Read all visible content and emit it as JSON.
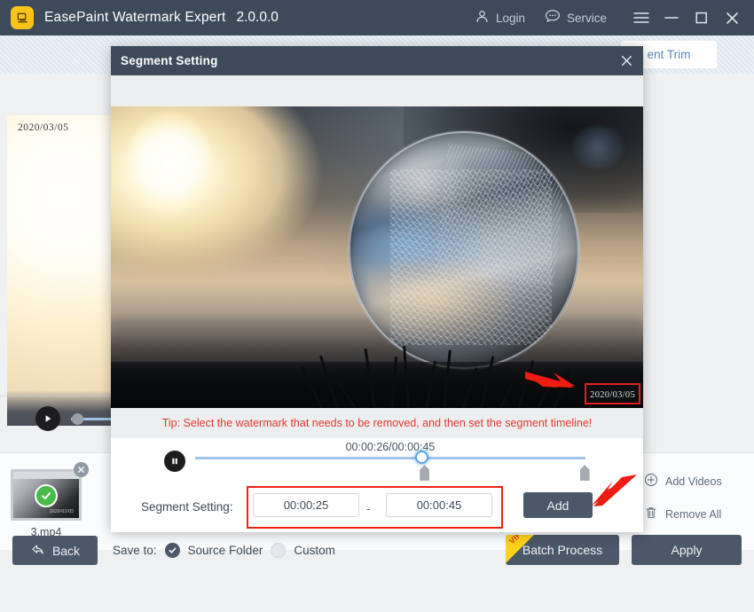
{
  "app": {
    "title": "EasePaint Watermark Expert",
    "version": "2.0.0.0",
    "logo_icon": "watermark-app-icon",
    "login_label": "Login",
    "login_icon": "user-icon",
    "service_label": "Service",
    "service_icon": "chat-bubble-icon",
    "menu_icon": "hamburger-menu-icon",
    "minimize_icon": "minimize-icon",
    "maximize_icon": "maximize-icon",
    "close_icon": "close-icon"
  },
  "background": {
    "tab_label": "ent Trim",
    "preview_watermark": "2020/03/05",
    "play_icon": "play-icon"
  },
  "filestrip": {
    "file_name": "3.mp4",
    "check_icon": "check-icon",
    "remove_icon": "close-icon",
    "thumb_watermark": "2020/03/05",
    "add_videos_label": "Add Videos",
    "add_videos_icon": "plus-circle-icon",
    "remove_all_label": "Remove All",
    "remove_all_icon": "trash-icon"
  },
  "bottom": {
    "back_label": "Back",
    "back_icon": "back-arrow-icon",
    "save_to_label": "Save to:",
    "source_folder_label": "Source Folder",
    "custom_label": "Custom",
    "batch_label": "Batch Process",
    "vip_badge": "VIP",
    "apply_label": "Apply"
  },
  "dialog": {
    "title": "Segment Setting",
    "close_icon": "close-icon",
    "video_watermark": "2020/03/05",
    "watermark_arrow_icon": "red-arrow-icon",
    "tip": "Tip: Select the watermark that needs to be removed, and then set the segment timeline!",
    "pause_icon": "pause-icon",
    "time_display": "00:00:26/00:00:45",
    "segment_label": "Segment Setting:",
    "start_time": "00:00:25",
    "end_time": "00:00:45",
    "range_separator": "-",
    "add_label": "Add",
    "add_arrow_icon": "red-arrow-icon"
  },
  "colors": {
    "titlebar": "#3c4a5a",
    "accent_button": "#4a586a",
    "tip_red": "#e23a2e",
    "highlight_red": "#ee2211",
    "track_blue": "#9ec5e8",
    "playhead_blue": "#5aa5e0",
    "vip_yellow": "#ffd21e",
    "logo_yellow": "#fbc21a",
    "check_green": "#49bb4a"
  },
  "timeline": {
    "playhead_percent": 58,
    "trim_start_percent": 58,
    "trim_end_percent": 99
  }
}
